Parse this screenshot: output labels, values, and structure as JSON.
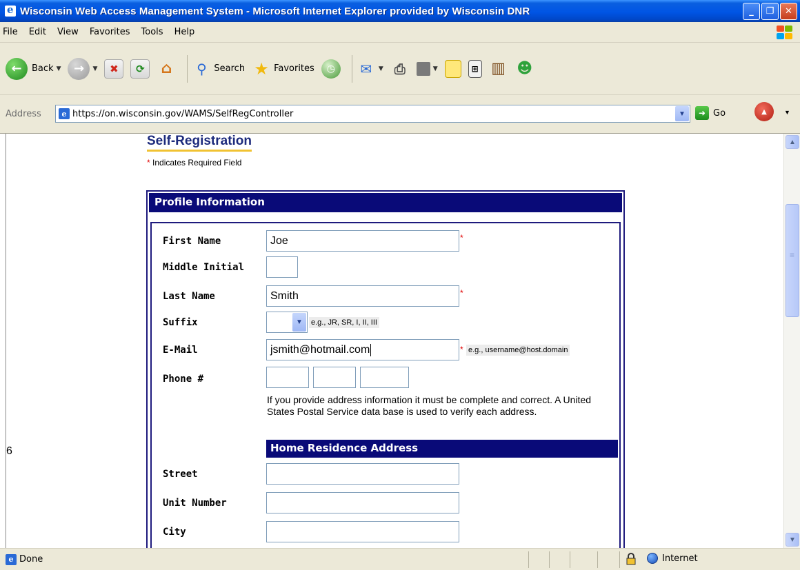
{
  "window": {
    "title": "Wisconsin Web Access Management System - Microsoft Internet Explorer provided by Wisconsin DNR",
    "minimize": "_",
    "maximize": "❐",
    "close": "✕"
  },
  "menu": [
    "File",
    "Edit",
    "View",
    "Favorites",
    "Tools",
    "Help"
  ],
  "toolbar": {
    "back_label": "Back",
    "search_label": "Search",
    "favorites_label": "Favorites"
  },
  "address": {
    "label": "Address",
    "url": "https://on.wisconsin.gov/WAMS/SelfRegController",
    "go_label": "Go"
  },
  "page": {
    "stray_char": "6",
    "heading": "Self-Registration",
    "required_star": "*",
    "required_note": " Indicates Required Field",
    "section_header": "Profile Information",
    "fields": {
      "first_name": {
        "label": "First Name",
        "value": "Joe"
      },
      "middle_initial": {
        "label": "Middle Initial",
        "value": ""
      },
      "last_name": {
        "label": "Last Name",
        "value": "Smith"
      },
      "suffix": {
        "label": "Suffix",
        "value": "",
        "hint": "e.g., JR, SR, I, II, III"
      },
      "email": {
        "label": "E-Mail",
        "value": "jsmith@hotmail.com",
        "hint": "e.g., username@host.domain"
      },
      "phone": {
        "label": "Phone #",
        "area": "",
        "prefix": "",
        "line": ""
      },
      "street": {
        "label": "Street",
        "value": ""
      },
      "unit_number": {
        "label": "Unit Number",
        "value": ""
      },
      "city": {
        "label": "City",
        "value": ""
      }
    },
    "required_mark": "*",
    "address_info": "If you provide address information it must be complete and correct.  A United States Postal Service data base is used to verify each address.",
    "address_header": "Home Residence Address"
  },
  "status": {
    "text": "Done",
    "zone": "Internet"
  },
  "colors": {
    "header_navy": "#090a78",
    "heading_blue": "#1c2a7c",
    "underline_gold": "#f1c232",
    "required_red": "#e00000"
  }
}
